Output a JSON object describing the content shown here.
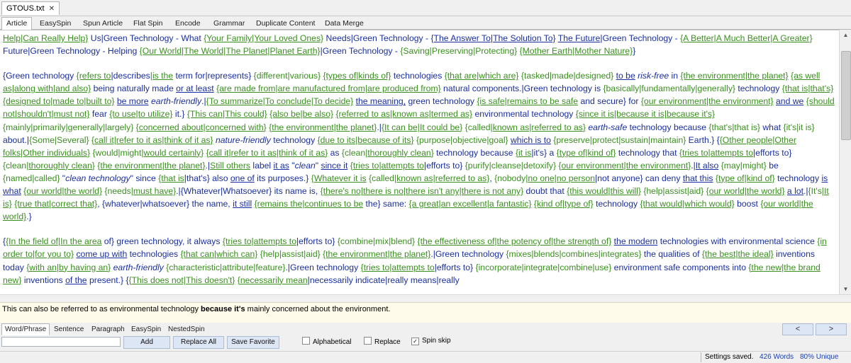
{
  "window": {
    "doc_tab": "GTOUS.txt",
    "close_glyph": "✕"
  },
  "tabs": [
    "Article",
    "EasySpin",
    "Spun Article",
    "Flat Spin",
    "Encode",
    "Grammar",
    "Duplicate Content",
    "Data Merge"
  ],
  "preview": {
    "before": "This can also be referred to as environmental technology ",
    "bold": "because it's",
    "after": " mainly concerned about the environment."
  },
  "lower_tabs": [
    "Word/Phrase",
    "Sentence",
    "Paragraph",
    "EasySpin",
    "NestedSpin"
  ],
  "nav": {
    "prev": "<",
    "next": ">"
  },
  "toolbar": {
    "add": "Add",
    "replace_all": "Replace All",
    "save_favorite": "Save Favorite",
    "alphabetical": "Alphabetical",
    "replace": "Replace",
    "spin_skip": "Spin skip"
  },
  "status": {
    "message": "Settings saved.",
    "words": "426 Words",
    "unique": "80% Unique"
  }
}
